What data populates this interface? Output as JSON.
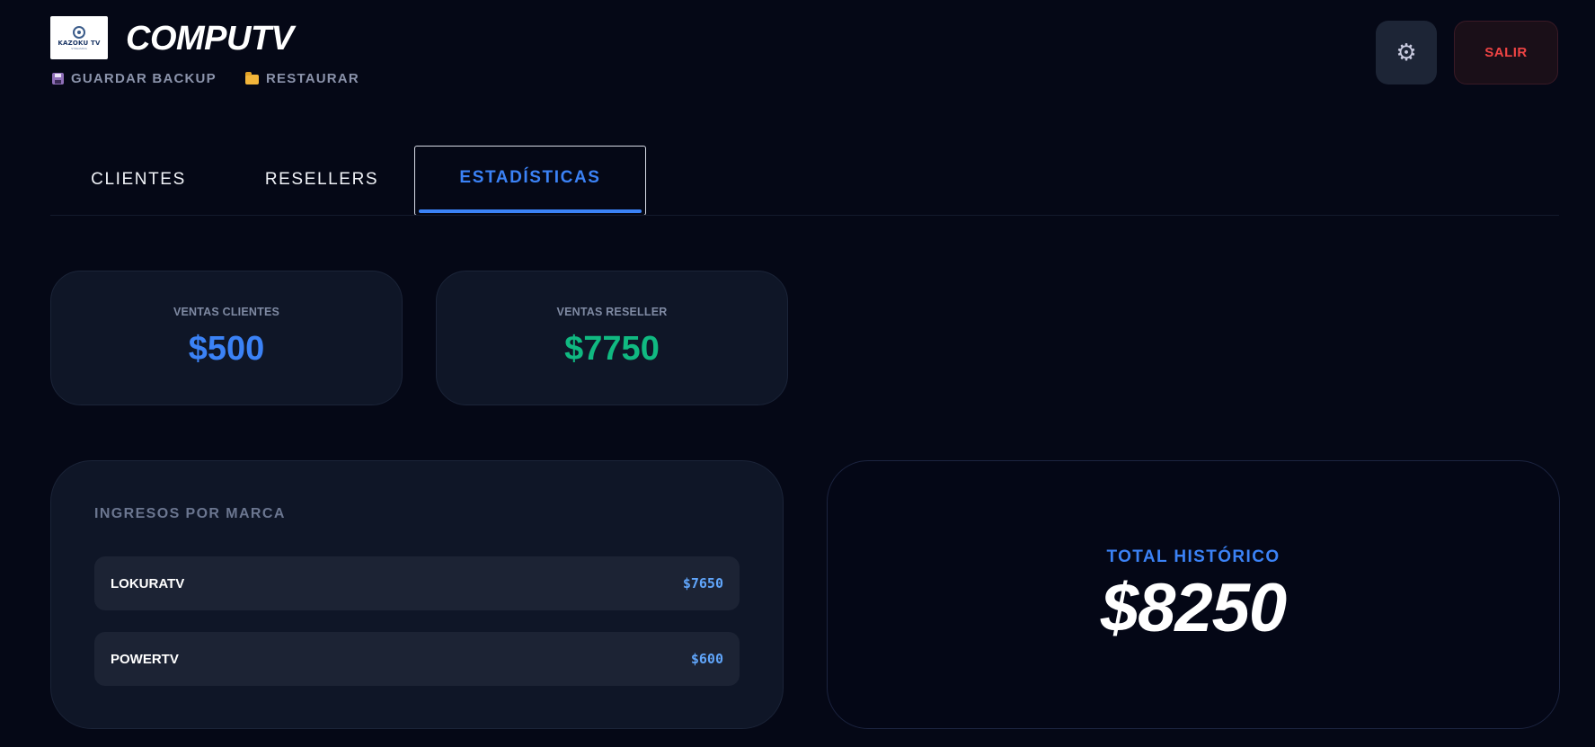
{
  "header": {
    "logo_text": "KAZOKU TV",
    "logo_sub": "STREAMING",
    "brand": "COMPUTV",
    "backup_label": "GUARDAR BACKUP",
    "restore_label": "RESTAURAR",
    "settings_icon": "gear-icon",
    "logout_label": "SALIR"
  },
  "tabs": [
    {
      "label": "CLIENTES",
      "active": false
    },
    {
      "label": "RESELLERS",
      "active": false
    },
    {
      "label": "ESTADÍSTICAS",
      "active": true
    }
  ],
  "stats": {
    "clientes": {
      "label": "VENTAS CLIENTES",
      "value": "$500"
    },
    "reseller": {
      "label": "VENTAS RESELLER",
      "value": "$7750"
    }
  },
  "ingresos": {
    "title": "INGRESOS POR MARCA",
    "rows": [
      {
        "brand": "LOKURATV",
        "amount": "$7650"
      },
      {
        "brand": "POWERTV",
        "amount": "$600"
      }
    ]
  },
  "total": {
    "label": "TOTAL HISTÓRICO",
    "value": "$8250"
  },
  "colors": {
    "accent": "#3b82f6",
    "success": "#10b981",
    "danger": "#ef4444",
    "background": "#050816"
  }
}
